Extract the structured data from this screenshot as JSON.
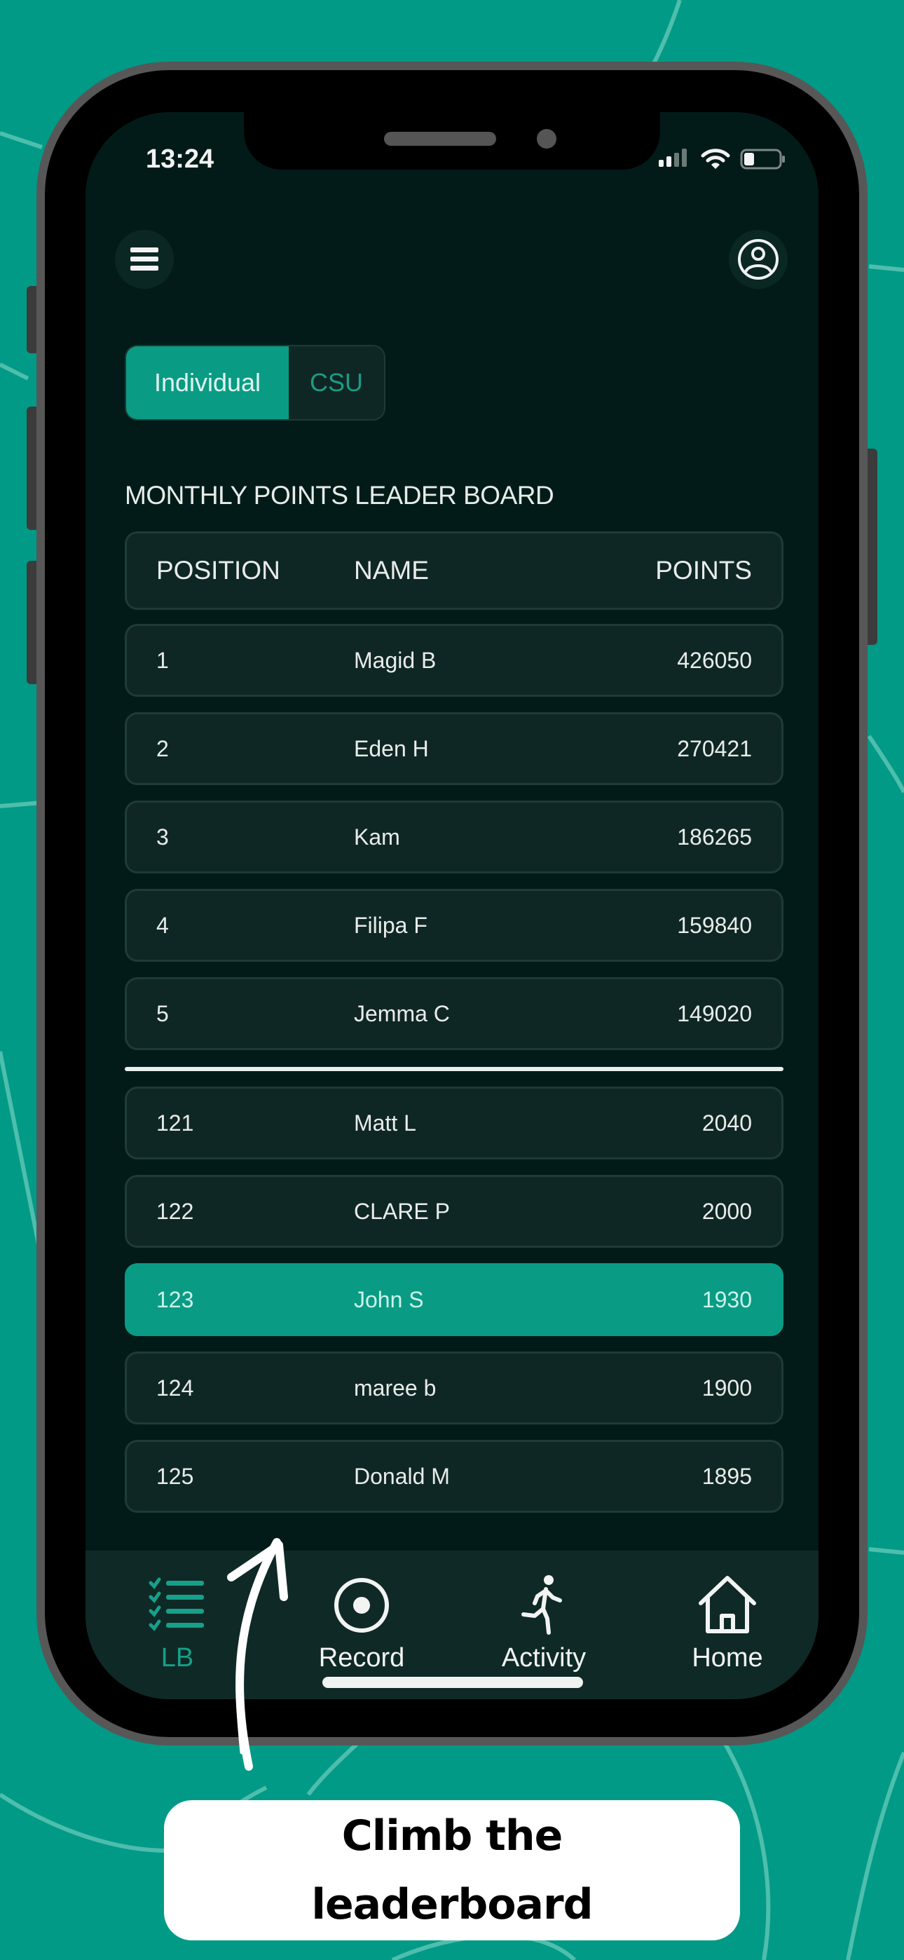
{
  "status_bar": {
    "time": "13:24",
    "icons": [
      "signal-icon",
      "wifi-icon",
      "battery-icon"
    ]
  },
  "header": {
    "menu_icon": "hamburger-menu-icon",
    "profile_icon": "user-circle-icon"
  },
  "segmented_control": {
    "options": [
      {
        "label": "Individual",
        "selected": true
      },
      {
        "label": "CSU",
        "selected": false
      }
    ]
  },
  "leaderboard": {
    "title": "MONTHLY POINTS LEADER BOARD",
    "columns": {
      "position": "POSITION",
      "name": "NAME",
      "points": "POINTS"
    },
    "top_rows": [
      {
        "position": "1",
        "name": "Magid B",
        "points": "426050"
      },
      {
        "position": "2",
        "name": "Eden H",
        "points": "270421"
      },
      {
        "position": "3",
        "name": "Kam",
        "points": "186265"
      },
      {
        "position": "4",
        "name": "Filipa F",
        "points": "159840"
      },
      {
        "position": "5",
        "name": "Jemma C",
        "points": "149020"
      }
    ],
    "nearby_rows": [
      {
        "position": "121",
        "name": "Matt L",
        "points": "2040",
        "current_user": false
      },
      {
        "position": "122",
        "name": "CLARE P",
        "points": "2000",
        "current_user": false
      },
      {
        "position": "123",
        "name": "John S",
        "points": "1930",
        "current_user": true
      },
      {
        "position": "124",
        "name": "maree b",
        "points": "1900",
        "current_user": false
      },
      {
        "position": "125",
        "name": "Donald M",
        "points": "1895",
        "current_user": false
      }
    ]
  },
  "tab_bar": {
    "tabs": [
      {
        "label": "LB",
        "icon": "checklist-icon",
        "active": true
      },
      {
        "label": "Record",
        "icon": "record-icon",
        "active": false
      },
      {
        "label": "Activity",
        "icon": "running-person-icon",
        "active": false
      },
      {
        "label": "Home",
        "icon": "home-icon",
        "active": false
      }
    ]
  },
  "caption": {
    "line1": "Climb the",
    "line2": "leaderboard"
  },
  "colors": {
    "background": "#019a87",
    "screen": "#021b19",
    "accent": "#0a9b84",
    "row": "#0f2724"
  }
}
